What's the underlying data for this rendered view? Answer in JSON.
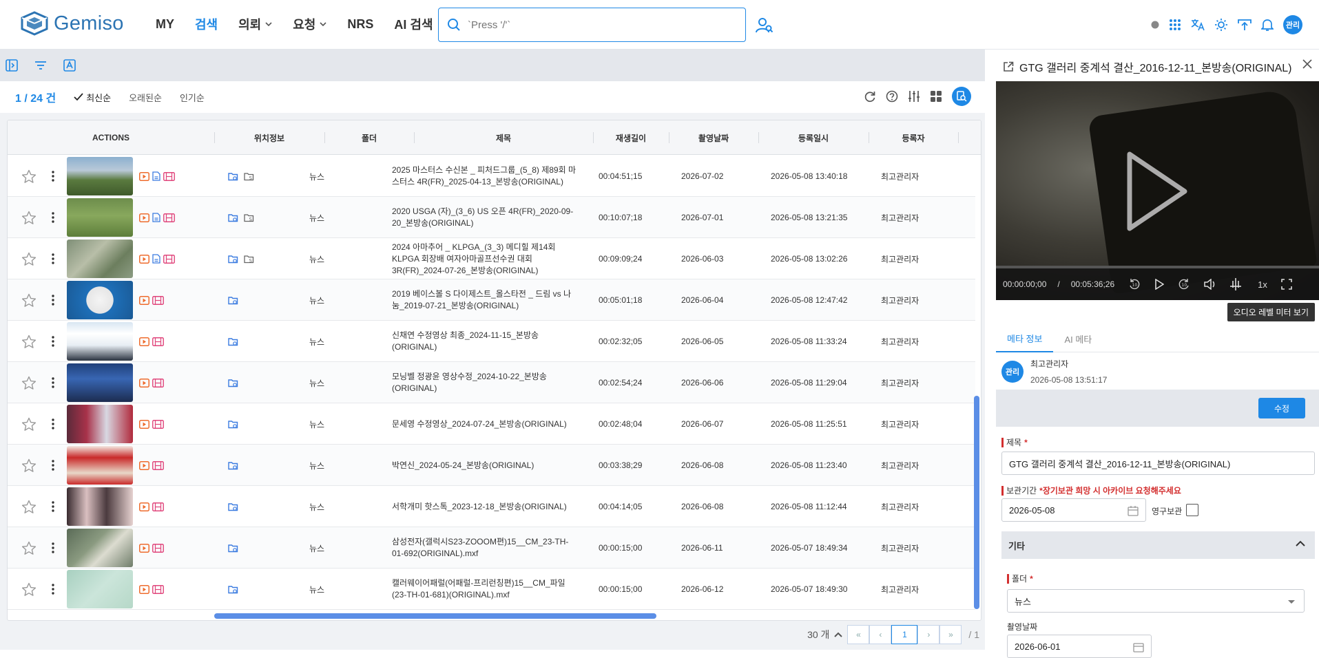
{
  "app": {
    "logo_text": "Gemiso",
    "brand_color": "#1e88e5"
  },
  "nav": {
    "items": [
      {
        "label": "MY",
        "active": false,
        "dropdown": false
      },
      {
        "label": "검색",
        "active": true,
        "dropdown": false
      },
      {
        "label": "의뢰",
        "active": false,
        "dropdown": true
      },
      {
        "label": "요청",
        "active": false,
        "dropdown": true
      },
      {
        "label": "NRS",
        "active": false,
        "dropdown": false
      },
      {
        "label": "AI 검색",
        "active": false,
        "dropdown": false
      }
    ]
  },
  "search": {
    "placeholder": "`Press '/'`"
  },
  "header": {
    "avatar_text": "관리"
  },
  "list": {
    "count": "1 / 24 건",
    "sort_options": [
      {
        "label": "최신순",
        "active": true
      },
      {
        "label": "오래된순",
        "active": false
      },
      {
        "label": "인기순",
        "active": false
      }
    ]
  },
  "table": {
    "columns": [
      "ACTIONS",
      "위치정보",
      "폴더",
      "제목",
      "재생길이",
      "촬영날짜",
      "등록일시",
      "등록자"
    ],
    "rows": [
      {
        "title": "2025 마스터스 수신본 _ 피처드그룹_(5_8) 제89회 마스터스 4R(FR)_2025-04-13_본방송(ORIGINAL)",
        "folder": "뉴스",
        "duration": "00:04:51;15",
        "shoot_date": "2026-07-02",
        "registered": "2026-05-08 13:40:18",
        "registrant": "최고관리자",
        "icons": 3,
        "loc": 2,
        "thumb": "golf"
      },
      {
        "title": "2020 USGA (자)_(3_6) US 오픈 4R(FR)_2020-09-20_본방송(ORIGINAL)",
        "folder": "뉴스",
        "duration": "00:10:07;18",
        "shoot_date": "2026-07-01",
        "registered": "2026-05-08 13:21:35",
        "registrant": "최고관리자",
        "icons": 3,
        "loc": 2,
        "thumb": "green"
      },
      {
        "title": "2024 아마추어 _ KLPGA_(3_3) 메디힐 제14회 KLPGA 회장배 여자아마골프선수권 대회 3R(FR)_2024-07-26_본방송(ORIGINAL)",
        "folder": "뉴스",
        "duration": "00:09:09;24",
        "shoot_date": "2026-06-03",
        "registered": "2026-05-08 13:02:26",
        "registrant": "최고관리자",
        "icons": 3,
        "loc": 2,
        "thumb": "aerial"
      },
      {
        "title": "2019 베이스볼 S 다이제스트_올스타전 _ 드림 vs 나눔_2019-07-21_본방송(ORIGINAL)",
        "folder": "뉴스",
        "duration": "00:05:01;18",
        "shoot_date": "2026-06-04",
        "registered": "2026-05-08 12:47:42",
        "registrant": "최고관리자",
        "icons": 2,
        "loc": 1,
        "thumb": "baseball"
      },
      {
        "title": "신채연 수정영상 최종_2024-11-15_본방송(ORIGINAL)",
        "folder": "뉴스",
        "duration": "00:02:32;05",
        "shoot_date": "2026-06-05",
        "registered": "2026-05-08 11:33:24",
        "registrant": "최고관리자",
        "icons": 2,
        "loc": 1,
        "thumb": "anchor1"
      },
      {
        "title": "모닝벨 정광윤 영상수정_2024-10-22_본방송(ORIGINAL)",
        "folder": "뉴스",
        "duration": "00:02:54;24",
        "shoot_date": "2026-06-06",
        "registered": "2026-05-08 11:29:04",
        "registrant": "최고관리자",
        "icons": 2,
        "loc": 1,
        "thumb": "anchor2"
      },
      {
        "title": "문세영 수정영상_2024-07-24_본방송(ORIGINAL)",
        "folder": "뉴스",
        "duration": "00:02:48;04",
        "shoot_date": "2026-06-07",
        "registered": "2026-05-08 11:25:51",
        "registrant": "최고관리자",
        "icons": 2,
        "loc": 1,
        "thumb": "studio"
      },
      {
        "title": "박연신_2024-05-24_본방송(ORIGINAL)",
        "folder": "뉴스",
        "duration": "00:03:38;29",
        "shoot_date": "2026-06-08",
        "registered": "2026-05-08 11:23:40",
        "registrant": "최고관리자",
        "icons": 2,
        "loc": 1,
        "thumb": "board"
      },
      {
        "title": "서학개미 핫스톡_2023-12-18_본방송(ORIGINAL)",
        "folder": "뉴스",
        "duration": "00:04:14;05",
        "shoot_date": "2026-06-08",
        "registered": "2026-05-08 11:12:44",
        "registrant": "최고관리자",
        "icons": 2,
        "loc": 1,
        "thumb": "anchor3"
      },
      {
        "title": "삼성전자(갤럭시S23-ZOOOM편)15__CM_23-TH-01-692(ORIGINAL).mxf",
        "folder": "뉴스",
        "duration": "00:00:15;00",
        "shoot_date": "2026-06-11",
        "registered": "2026-05-07 18:49:34",
        "registrant": "최고관리자",
        "icons": 2,
        "loc": 1,
        "thumb": "phone"
      },
      {
        "title": "캘러웨이어패럴(어패럴-프리런칭편)15__CM_파일(23-TH-01-681)(ORIGINAL).mxf",
        "folder": "뉴스",
        "duration": "00:00:15;00",
        "shoot_date": "2026-06-12",
        "registered": "2026-05-07 18:49:30",
        "registrant": "최고관리자",
        "icons": 2,
        "loc": 1,
        "thumb": "mint"
      }
    ]
  },
  "pagination": {
    "page_size": "30 개",
    "current_page": "1",
    "total_pages": "/ 1"
  },
  "detail": {
    "title": "GTG 갤러리 중계석 결산_2016-12-11_본방송(ORIGINAL)",
    "player": {
      "current_time": "00:00:00;00",
      "separator": "/",
      "total_time": "00:05:36;26",
      "speed": "1x",
      "tooltip": "오디오 레벨 미터 보기"
    },
    "tabs": [
      {
        "label": "메타 정보",
        "active": true
      },
      {
        "label": "AI 메타",
        "active": false
      }
    ],
    "meta_avatar": "관리",
    "meta_user": "최고관리자",
    "meta_date": "2026-05-08 13:51:17",
    "edit_label": "수정",
    "fields": {
      "title_label": "제목",
      "title_required": "*",
      "title_value": "GTG 갤러리 중계석 결산_2016-12-11_본방송(ORIGINAL)",
      "retention_label": "보관기간",
      "retention_note": "*장기보관 희망 시 아카이브 요청해주세요",
      "retention_value": "2026-05-08",
      "permanent_label": "영구보관",
      "section_label": "기타",
      "folder_label": "폴더",
      "folder_required": "*",
      "folder_value": "뉴스",
      "shoot_label": "촬영날짜",
      "shoot_value": "2026-06-01"
    }
  }
}
